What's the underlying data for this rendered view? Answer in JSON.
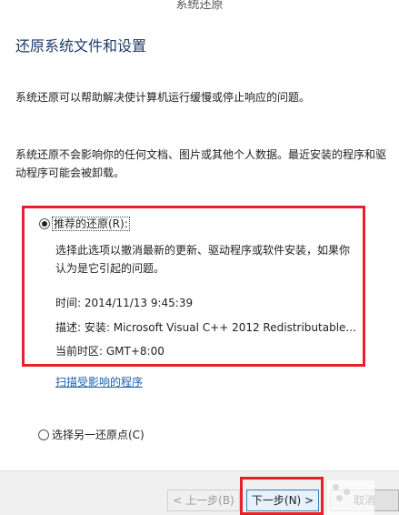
{
  "window": {
    "title": "系统还原"
  },
  "heading": "还原系统文件和设置",
  "intro": {
    "line1": "系统还原可以帮助解决使计算机运行缓慢或停止响应的问题。",
    "line2": "系统还原不会影响你的任何文档、图片或其他个人数据。最近安装的程序和驱动程序可能会被卸载。"
  },
  "recommended": {
    "label": "推荐的还原(R):",
    "selected": true,
    "description": "选择此选项以撤消最新的更新、驱动程序或软件安装，如果你认为是它引起的问题。",
    "time": "时间: 2014/11/13 9:45:39",
    "describe": "描述: 安装: Microsoft Visual C++ 2012 Redistributable...",
    "timezone": "当前时区: GMT+8:00"
  },
  "scan_link": "扫描受影响的程序",
  "other": {
    "label": "选择另一还原点(C)",
    "selected": false
  },
  "buttons": {
    "back": "< 上一步(B)",
    "next": "下一步(N) >",
    "cancel": "取消"
  },
  "colors": {
    "highlight": "#e8202b",
    "link": "#1a5fb4",
    "heading": "#1c3a6b"
  }
}
